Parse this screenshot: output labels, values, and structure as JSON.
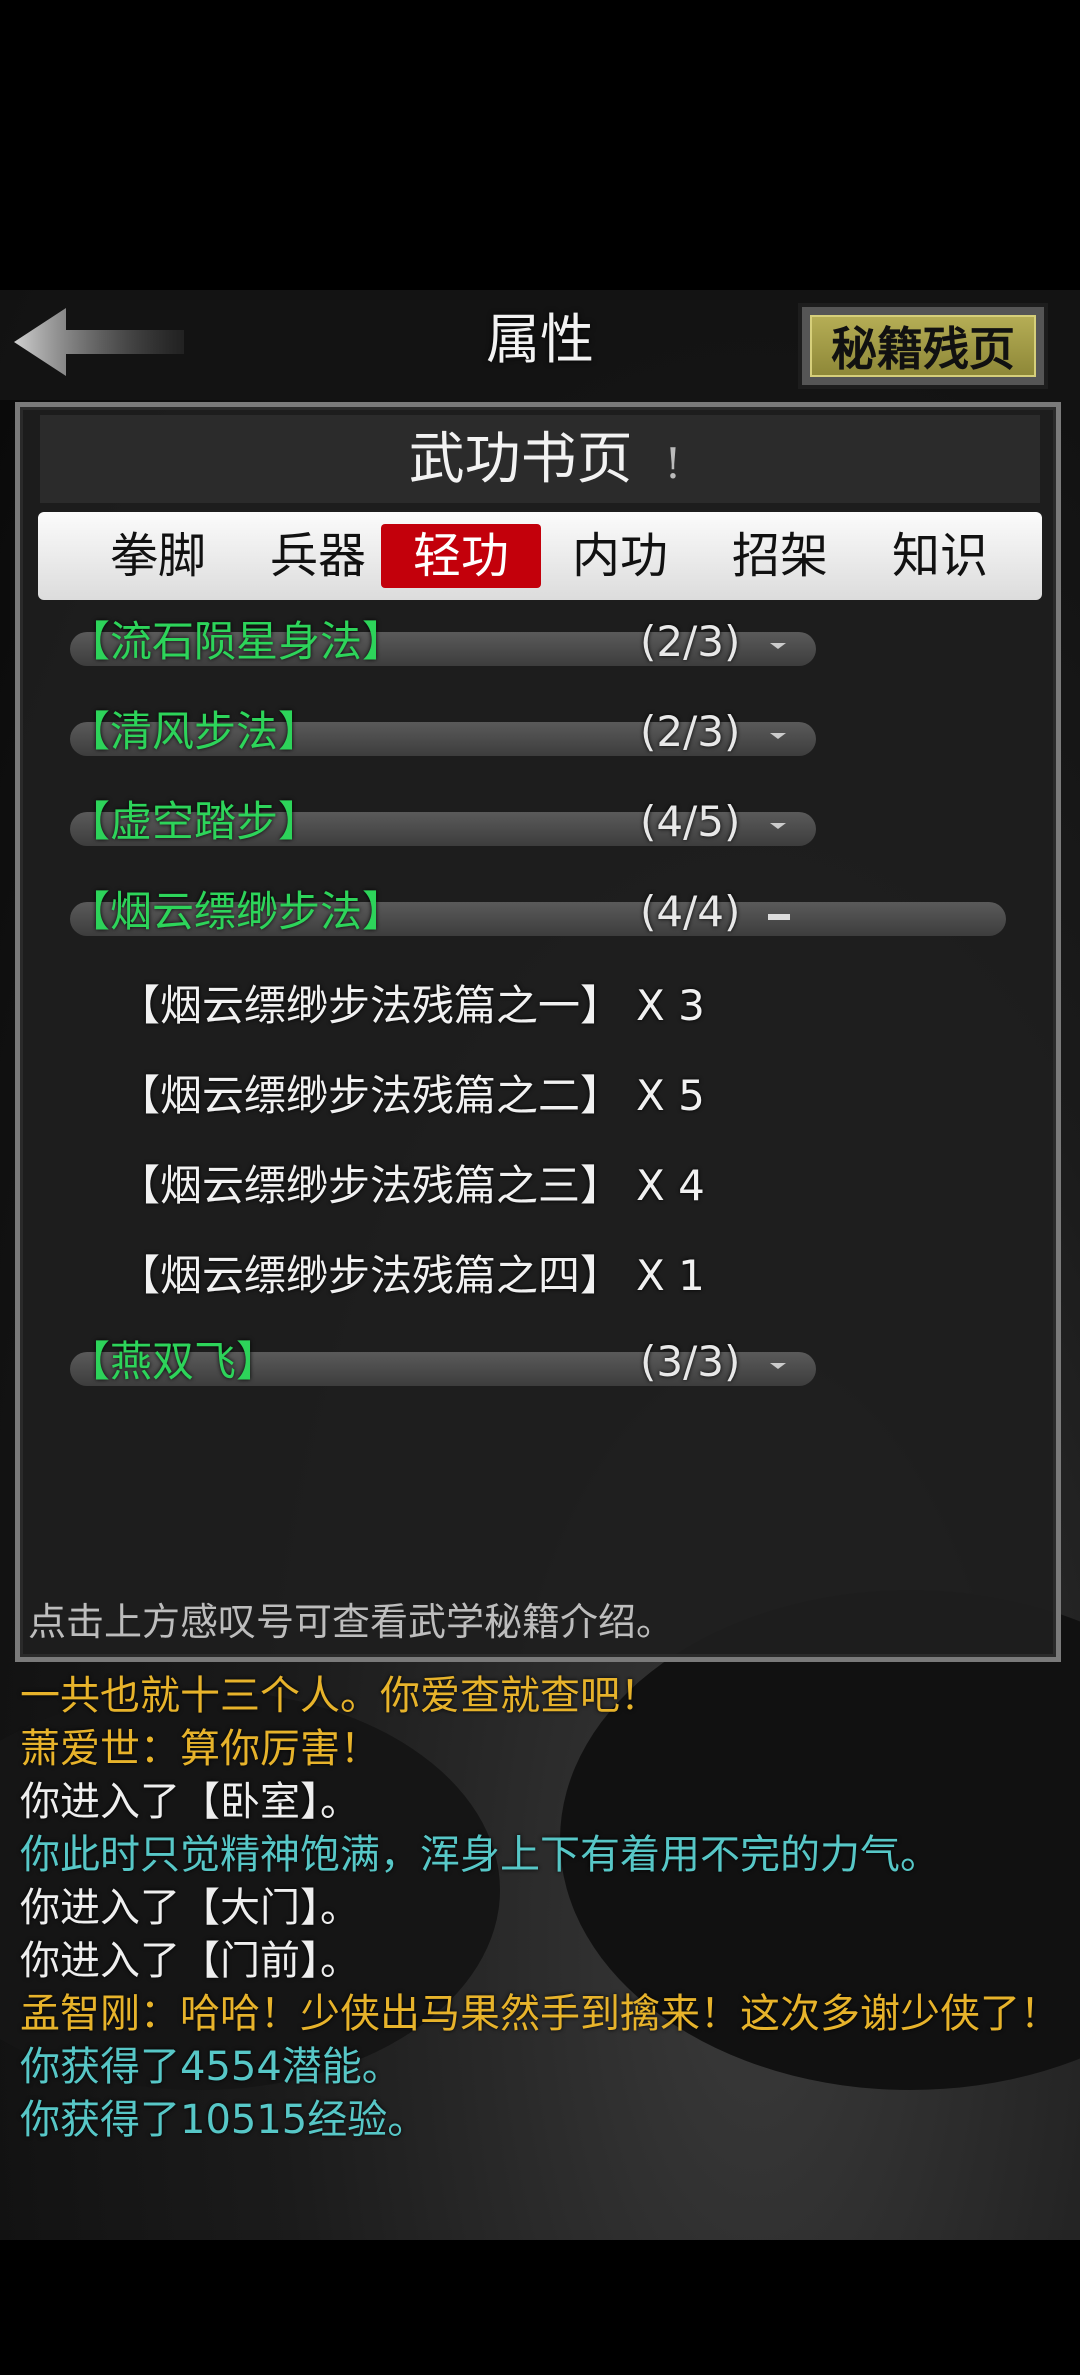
{
  "header": {
    "title": "属性",
    "secret_button": "秘籍残页"
  },
  "panel": {
    "title": "武功书页",
    "info_mark": "!",
    "tabs": [
      {
        "label": "拳脚",
        "active": false
      },
      {
        "label": "兵器",
        "active": false
      },
      {
        "label": "轻功",
        "active": true
      },
      {
        "label": "内功",
        "active": false
      },
      {
        "label": "招架",
        "active": false
      },
      {
        "label": "知识",
        "active": false
      }
    ],
    "books": [
      {
        "name": "【流石陨星身法】",
        "count": "(2/3)",
        "expanded": false
      },
      {
        "name": "【清风步法】",
        "count": "(2/3)",
        "expanded": false
      },
      {
        "name": "【虚空踏步】",
        "count": "(4/5)",
        "expanded": false
      },
      {
        "name": "【烟云缥缈步法】",
        "count": "(4/4)",
        "expanded": true
      },
      {
        "name": "【燕双飞】",
        "count": "(3/3)",
        "expanded": false
      }
    ],
    "fragments": [
      {
        "name": "【烟云缥缈步法残篇之一】",
        "qty": "X 3"
      },
      {
        "name": "【烟云缥缈步法残篇之二】",
        "qty": "X 5"
      },
      {
        "name": "【烟云缥缈步法残篇之三】",
        "qty": "X 4"
      },
      {
        "name": "【烟云缥缈步法残篇之四】",
        "qty": "X 1"
      }
    ],
    "hint": "点击上方感叹号可查看武学秘籍介绍。"
  },
  "log": [
    {
      "text": "一共也就十三个人。你爱查就查吧！",
      "color": "gold"
    },
    {
      "text": "萧爱世：算你厉害！",
      "color": "gold"
    },
    {
      "text": "你进入了【卧室】。",
      "color": "white"
    },
    {
      "text": "你此时只觉精神饱满，浑身上下有着用不完的力气。",
      "color": "teal"
    },
    {
      "text": "你进入了【大门】。",
      "color": "white"
    },
    {
      "text": "你进入了【门前】。",
      "color": "white"
    },
    {
      "text": "孟智刚：哈哈！少侠出马果然手到擒来！这次多谢少侠了！",
      "color": "gold"
    },
    {
      "text": "你获得了4554潜能。",
      "color": "teal"
    },
    {
      "text": "你获得了10515经验。",
      "color": "teal"
    }
  ],
  "colors": {
    "accent_red": "#c3000b",
    "book_green": "#2dd45a",
    "log_gold": "#e7b32b",
    "log_teal": "#57c7c7"
  }
}
